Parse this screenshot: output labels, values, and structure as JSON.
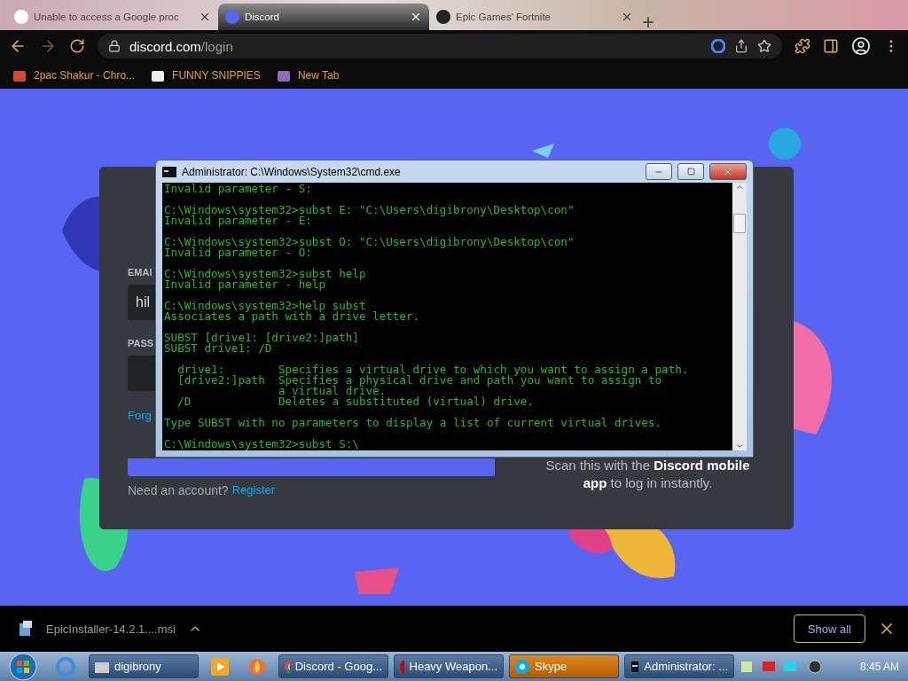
{
  "browser": {
    "tabs": [
      {
        "title": "Unable to access a Google proc",
        "selected": false
      },
      {
        "title": "Discord",
        "selected": true
      },
      {
        "title": "Epic Games' Fortnite",
        "selected": false
      }
    ],
    "address": {
      "host": "discord.com",
      "path": "/login"
    },
    "bookmarks": [
      {
        "label": "2pac Shakur - Chro..."
      },
      {
        "label": "FUNNY SNIPPIES"
      },
      {
        "label": "New Tab"
      }
    ]
  },
  "login_card": {
    "email_label": "EMAI",
    "email_value": "hil",
    "password_label": "PASS",
    "forgot_link": "Forg",
    "need_account": "Need an account?",
    "register_link": "Register",
    "qr_text": "Scan this with the **Discord mobile app** to log in instantly."
  },
  "cmd_window": {
    "title": "Administrator: C:\\Windows\\System32\\cmd.exe",
    "blocks": [
      [
        "Invalid parameter - S:"
      ],
      [
        "C:\\Windows\\system32>subst E: \"C:\\Users\\digibrony\\Desktop\\con\"",
        "Invalid parameter - E:"
      ],
      [
        "C:\\Windows\\system32>subst O: \"C:\\Users\\digibrony\\Desktop\\con\"",
        "Invalid parameter - O:"
      ],
      [
        "C:\\Windows\\system32>subst help",
        "Invalid parameter - help"
      ],
      [
        "C:\\Windows\\system32>help subst",
        "Associates a path with a drive letter."
      ],
      [
        "SUBST [drive1: [drive2:]path]",
        "SUBST drive1: /D"
      ],
      [
        "  drive1:        Specifies a virtual drive to which you want to assign a path.",
        "  [drive2:]path  Specifies a physical drive and path you want to assign to",
        "                 a virtual drive.",
        "  /D             Deletes a substituted (virtual) drive."
      ],
      [
        "Type SUBST with no parameters to display a list of current virtual drives."
      ],
      [
        "C:\\Windows\\system32>subst S:\\"
      ]
    ]
  },
  "download_bar": {
    "file": "EpicInstaller-14.2.1....msi",
    "show_all": "Show all"
  },
  "taskbar": {
    "items": [
      {
        "kind": "button",
        "label": "digibrony",
        "selected": false
      },
      {
        "kind": "icon"
      },
      {
        "kind": "icon"
      },
      {
        "kind": "button",
        "label": "Discord - Goog...",
        "selected": false
      },
      {
        "kind": "button",
        "label": "Heavy Weapon...",
        "selected": false
      },
      {
        "kind": "button",
        "label": "Skype",
        "selected": true
      },
      {
        "kind": "button",
        "label": "Administrator: ...",
        "selected": false
      }
    ],
    "clock": "8:45 AM"
  }
}
